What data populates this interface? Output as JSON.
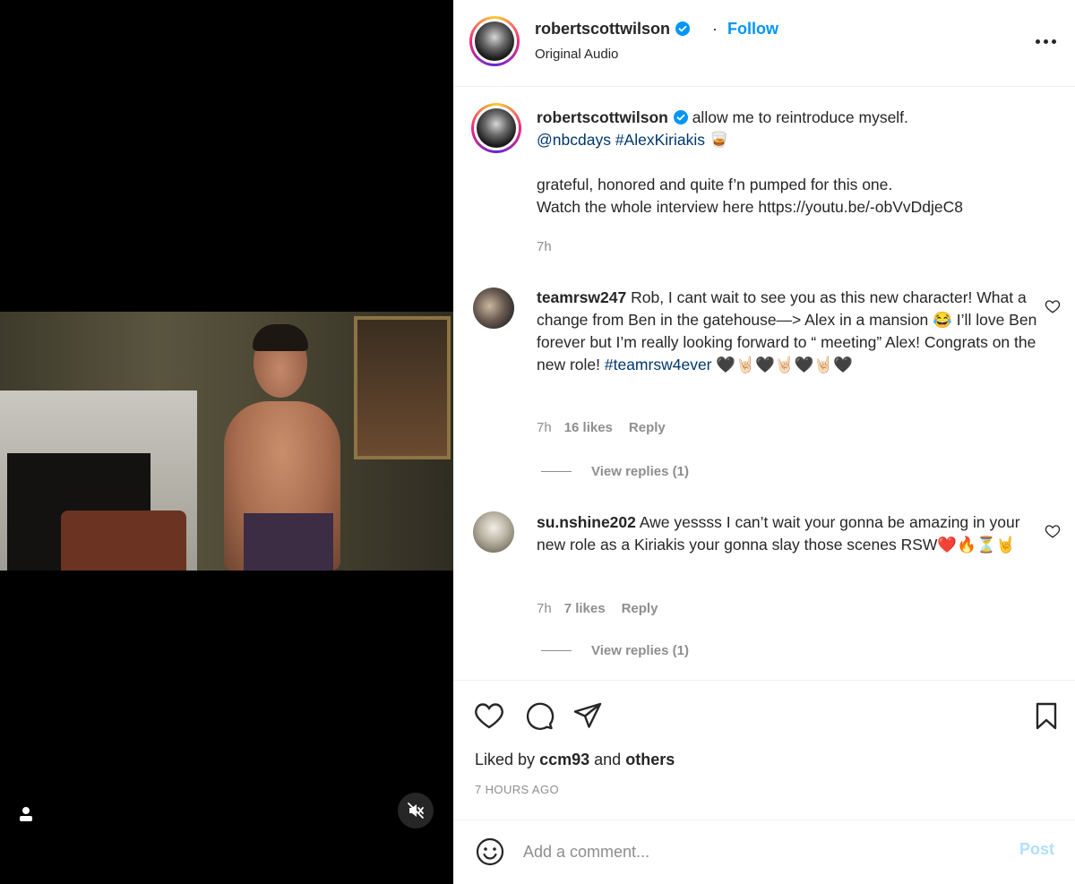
{
  "video": {
    "user_icon": "person-icon",
    "mute_icon": "muted-speaker-icon"
  },
  "header": {
    "username": "robertscottwilson",
    "separator": "·",
    "follow_label": "Follow",
    "subtitle": "Original Audio",
    "verified_icon": "verified-badge-icon",
    "more_icon": "more-options-icon"
  },
  "caption": {
    "username": "robertscottwilson",
    "text_line1": "allow me to reintroduce myself.",
    "mention": "@nbcdays",
    "hashtag": "#AlexKiriakis",
    "emoji": "🥃",
    "body_line1": "grateful, honored and quite f’n pumped for this one.",
    "body_line2": "Watch the whole interview here https://youtu.be/-obVvDdjeC8",
    "time": "7h"
  },
  "comments": [
    {
      "username": "teamrsw247",
      "text_before_tag": "Rob, I cant wait to see you as this new character! What a change from Ben in the gatehouse—> Alex in a mansion 😂 I’ll love Ben forever but I’m really looking forward to “ meeting” Alex! Congrats on the new role! ",
      "hashtag": "#teamrsw4ever",
      "emojis": " 🖤🤘🏻🖤🤘🏻🖤🤘🏻🖤",
      "time": "7h",
      "likes": "16 likes",
      "reply_label": "Reply",
      "view_replies": "View replies (1)"
    },
    {
      "username": "su.nshine202",
      "text": "Awe yessss I can’t wait your gonna be amazing in your new role as a Kiriakis your gonna slay those scenes RSW❤️🔥⏳🤘",
      "time": "7h",
      "likes": "7 likes",
      "reply_label": "Reply",
      "view_replies": "View replies (1)"
    }
  ],
  "actions": {
    "like_icon": "heart-icon",
    "comment_icon": "comment-icon",
    "share_icon": "paper-plane-icon",
    "save_icon": "bookmark-icon",
    "liked_by_prefix": "Liked by",
    "liked_by_user": "ccm93",
    "liked_by_and": "and",
    "liked_by_others": "others",
    "time_ago": "7 HOURS AGO"
  },
  "add_comment": {
    "emoji_icon": "smiley-icon",
    "placeholder": "Add a comment...",
    "post_label": "Post"
  },
  "colors": {
    "accent": "#0095f6",
    "link": "#00376b",
    "muted_text": "#8e8e8e",
    "post_disabled": "#b2dffc"
  }
}
